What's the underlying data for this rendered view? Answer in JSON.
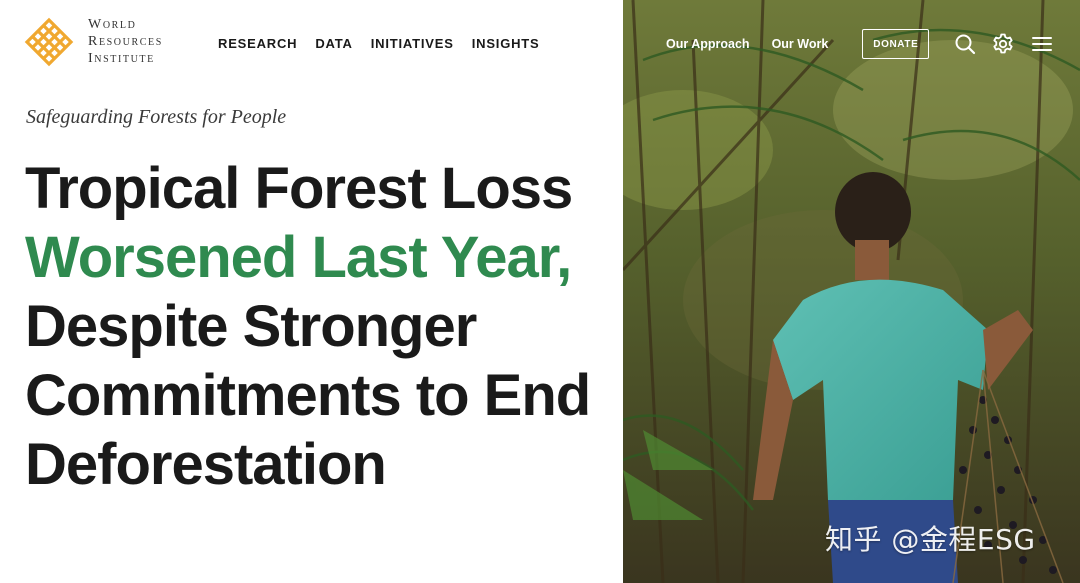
{
  "brand": {
    "logo_lines": [
      "World",
      "Resources",
      "Institute"
    ],
    "logo_color": "#f0a830"
  },
  "main_nav": [
    {
      "label": "RESEARCH"
    },
    {
      "label": "DATA"
    },
    {
      "label": "INITIATIVES"
    },
    {
      "label": "INSIGHTS"
    }
  ],
  "secondary_nav": {
    "links": [
      {
        "label": "Our Approach"
      },
      {
        "label": "Our Work"
      }
    ],
    "donate_label": "DONATE",
    "icons": [
      "search-icon",
      "gear-icon",
      "menu-icon"
    ]
  },
  "article": {
    "kicker": "Safeguarding Forests for People",
    "headline": {
      "part1": "Tropical Forest Loss ",
      "highlight": "Worsened Last Year,",
      "part2": " Despite Stronger Commitments to End Deforestation"
    },
    "highlight_color": "#2f8a4f"
  },
  "watermark": "知乎 @金程ESG"
}
